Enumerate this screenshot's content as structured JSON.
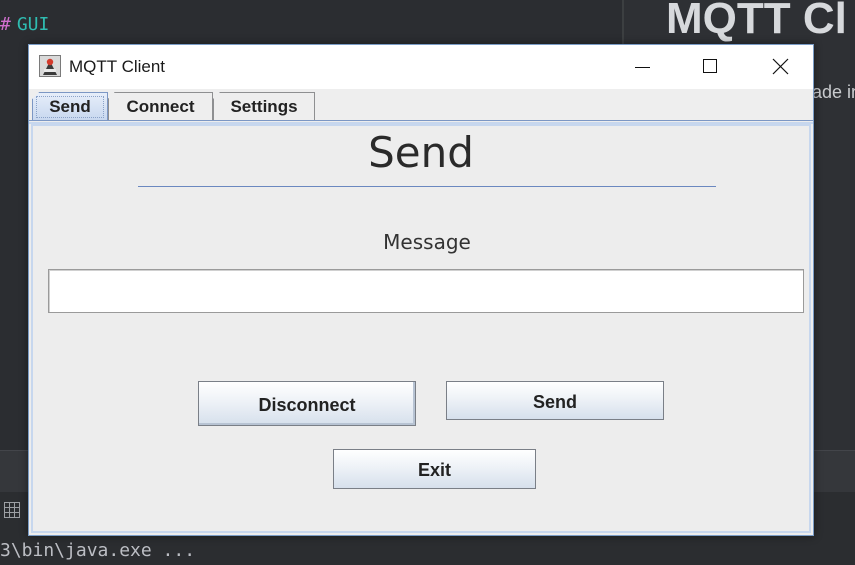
{
  "background": {
    "code_line": "GUI",
    "code_prefix": "#",
    "doc_heading": "MQTT Cl",
    "doc_text": "ade in",
    "console_text": "3\\bin\\java.exe ..."
  },
  "window": {
    "title": "MQTT Client",
    "controls": {
      "minimize": "minimize",
      "maximize": "maximize",
      "close": "close"
    }
  },
  "tabs": [
    {
      "label": "Send",
      "active": true
    },
    {
      "label": "Connect",
      "active": false
    },
    {
      "label": "Settings",
      "active": false
    }
  ],
  "send_panel": {
    "heading": "Send",
    "message_label": "Message",
    "message_value": "",
    "buttons": {
      "disconnect": "Disconnect",
      "send": "Send",
      "exit": "Exit"
    }
  },
  "colors": {
    "ide_background": "#2b2d30",
    "window_border": "#7a9cc6",
    "tab_active": "#c8d8ef",
    "heading_rule": "#6b88c0"
  }
}
